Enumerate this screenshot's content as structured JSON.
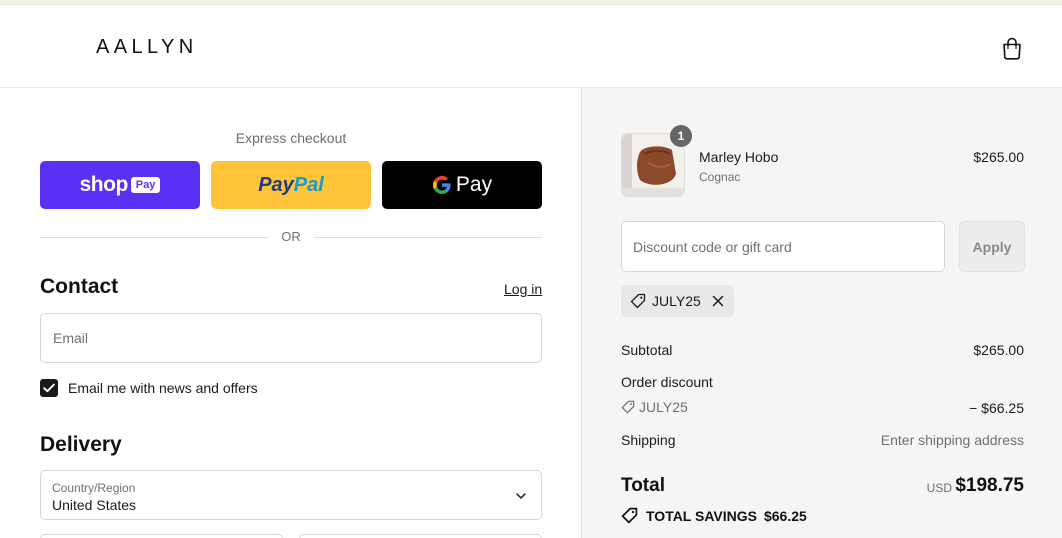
{
  "brand": {
    "logo": "AALLYN"
  },
  "express": {
    "label": "Express checkout",
    "shop_label": "shop",
    "shop_pay_label": "Pay",
    "paypal_part1": "Pay",
    "paypal_part2": "Pal",
    "gpay_label": "Pay",
    "or_label": "OR"
  },
  "contact": {
    "heading": "Contact",
    "login_label": "Log in",
    "email_placeholder": "Email",
    "newsletter_label": "Email me with news and offers",
    "newsletter_checked": true
  },
  "delivery": {
    "heading": "Delivery",
    "country_label": "Country/Region",
    "country_value": "United States"
  },
  "summary": {
    "item": {
      "name": "Marley Hobo",
      "variant": "Cognac",
      "price": "$265.00",
      "quantity": "1"
    },
    "discount_placeholder": "Discount code or gift card",
    "apply_label": "Apply",
    "applied_code": "JULY25",
    "subtotal_label": "Subtotal",
    "subtotal_value": "$265.00",
    "order_discount_label": "Order discount",
    "discount_code": "JULY25",
    "discount_value": "− $66.25",
    "shipping_label": "Shipping",
    "shipping_value": "Enter shipping address",
    "total_label": "Total",
    "total_currency": "USD",
    "total_value": "$198.75",
    "savings_label": "TOTAL SAVINGS",
    "savings_value": "$66.25"
  },
  "colors": {
    "shop_pay": "#5a31f4",
    "paypal": "#ffc439",
    "gpay": "#000000",
    "summary_bg": "#f5f5f5"
  }
}
